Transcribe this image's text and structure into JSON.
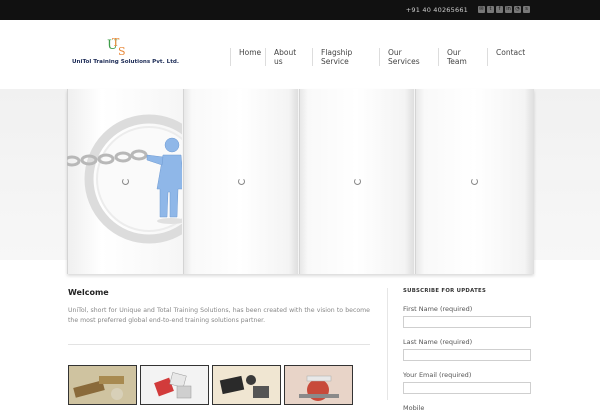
{
  "topbar": {
    "phone": "+91 40 40265661",
    "social_icons": [
      "mail-icon",
      "twitter-icon",
      "facebook-icon",
      "linkedin-icon",
      "rss-icon",
      "skype-icon"
    ]
  },
  "brand": {
    "logo_letters": "UTS",
    "company_name": "UniTol Training Solutions Pvt. Ltd.",
    "colors": {
      "orange": "#e8893a",
      "green": "#3f9d4a",
      "navy": "#1b2a55"
    }
  },
  "nav": {
    "items": [
      {
        "label": "Home"
      },
      {
        "label": "About us"
      },
      {
        "label": "Flagship Service"
      },
      {
        "label": "Our Services"
      },
      {
        "label": "Our Team"
      },
      {
        "label": "Contact"
      }
    ]
  },
  "welcome": {
    "title": "Welcome",
    "text": "UniTol, short for Unique and Total Training Solutions, has been created with the vision to become the most preferred global end-to-end training solutions partner."
  },
  "subscribe": {
    "title": "SUBSCRIBE FOR UPDATES",
    "fields": [
      {
        "label": "First Name (required)",
        "value": ""
      },
      {
        "label": "Last Name (required)",
        "value": ""
      },
      {
        "label": "Your Email (required)",
        "value": ""
      },
      {
        "label": "Mobile",
        "value": ""
      }
    ]
  }
}
